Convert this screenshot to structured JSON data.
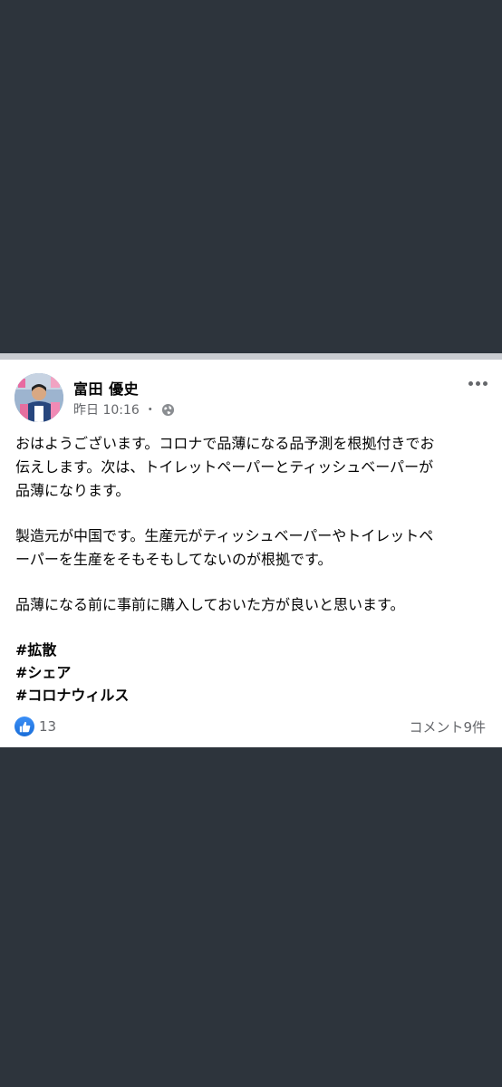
{
  "post": {
    "author": "富田 優史",
    "time": "昨日 10:16",
    "separator": "・",
    "privacy_icon": "globe-icon",
    "paragraphs": [
      "おはようございます。コロナで品薄になる品予測を根拠付きでお\n伝えします。次は、トイレットペーパーとティッシュベーパーが\n品薄になります。",
      "製造元が中国です。生産元がティッシュベーパーやトイレットペ\nーパーを生産をそもそもしてないのが根拠です。",
      "品薄になる前に事前に購入しておいた方が良いと思います。"
    ],
    "hashtags": [
      "#拡散",
      "#シェア",
      "#コロナウィルス"
    ],
    "reactions": {
      "icon": "thumbs-up-icon",
      "count": "13"
    },
    "comments": "コメント9件"
  },
  "colors": {
    "background": "#2d343c",
    "card": "#ffffff",
    "like_blue": "#1877f2",
    "secondary_text": "#65676b"
  }
}
